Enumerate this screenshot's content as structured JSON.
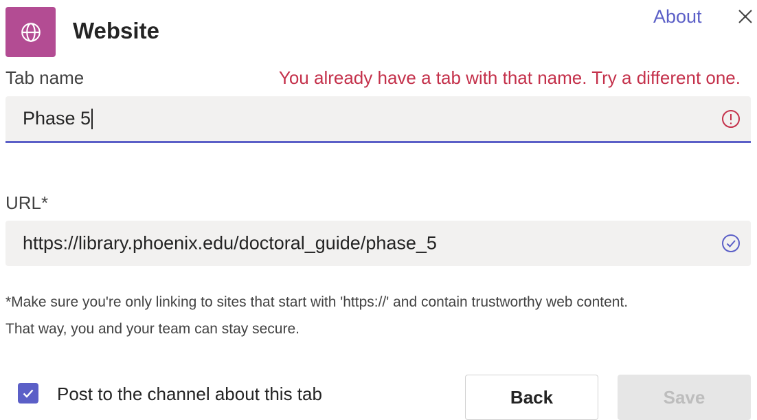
{
  "header": {
    "title": "Website",
    "app_icon": "globe-icon",
    "app_icon_bg": "#b34c93",
    "about_label": "About",
    "close_icon": "close-icon"
  },
  "tab_name": {
    "label": "Tab name",
    "error": "You already have a tab with that name. Try a different one.",
    "value": "Phase 5",
    "status_icon": "error-circle-icon"
  },
  "url": {
    "label": "URL*",
    "value": "https://library.phoenix.edu/doctoral_guide/phase_5",
    "status_icon": "check-circle-icon"
  },
  "note": {
    "line1": "*Make sure you're only linking to sites that start with 'https://' and contain trustworthy web content.",
    "line2": "That way, you and your team can stay secure."
  },
  "footer": {
    "post_checkbox_checked": true,
    "post_label": "Post to the channel about this tab",
    "back_label": "Back",
    "save_label": "Save",
    "save_disabled": true
  },
  "colors": {
    "accent": "#5b5fc7",
    "error": "#c4314b",
    "input_bg": "#f2f1f0"
  }
}
